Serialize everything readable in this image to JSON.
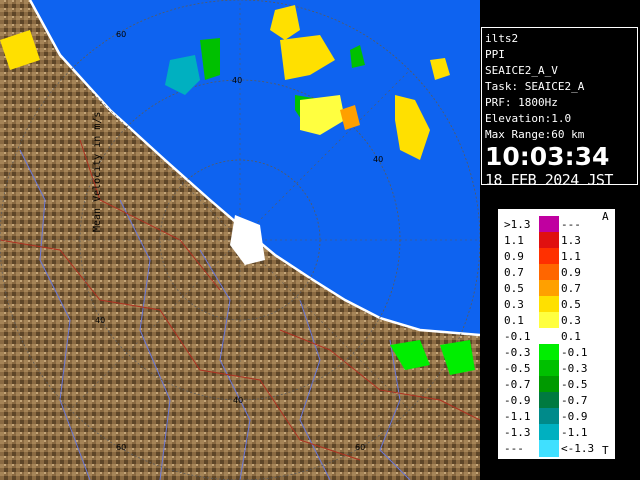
{
  "info": {
    "site": "ilts2",
    "scan_type": "PPI",
    "product": "SEAICE2_A_V",
    "task": "Task: SEAICE2_A",
    "prf": "PRF: 1800Hz",
    "elevation": "Elevation:1.0",
    "max_range": "Max Range:60 km",
    "time": "10:03:34",
    "date": "18 FEB 2024 JST"
  },
  "map": {
    "range_ring_labels": [
      "60",
      "40",
      "40",
      "40",
      "40",
      "60",
      "60"
    ],
    "colors": {
      "sea": "#0e63f0",
      "land": "#8a6a42",
      "coast": "#ffffff"
    }
  },
  "legend": {
    "title": "Mean Velocity in m/s",
    "top_marker": "A",
    "bottom_marker": "T",
    "rows": [
      {
        "left": ">1.3",
        "right": "---",
        "color": "#c000a0"
      },
      {
        "left": "1.1",
        "right": "1.3",
        "color": "#e01010"
      },
      {
        "left": "0.9",
        "right": "1.1",
        "color": "#ff3000"
      },
      {
        "left": "0.7",
        "right": "0.9",
        "color": "#ff6600"
      },
      {
        "left": "0.5",
        "right": "0.7",
        "color": "#ffa000"
      },
      {
        "left": "0.3",
        "right": "0.5",
        "color": "#ffe000"
      },
      {
        "left": "0.1",
        "right": "0.3",
        "color": "#ffff40"
      },
      {
        "left": "-0.1",
        "right": "0.1",
        "color": "#ffffff"
      },
      {
        "left": "-0.3",
        "right": "-0.1",
        "color": "#00ee00"
      },
      {
        "left": "-0.5",
        "right": "-0.3",
        "color": "#00c000"
      },
      {
        "left": "-0.7",
        "right": "-0.5",
        "color": "#009a00"
      },
      {
        "left": "-0.9",
        "right": "-0.7",
        "color": "#007a40"
      },
      {
        "left": "-1.1",
        "right": "-0.9",
        "color": "#008a8a"
      },
      {
        "left": "-1.3",
        "right": "-1.1",
        "color": "#00b0c0"
      },
      {
        "left": "---",
        "right": "<-1.3",
        "color": "#40e0ff"
      }
    ]
  }
}
